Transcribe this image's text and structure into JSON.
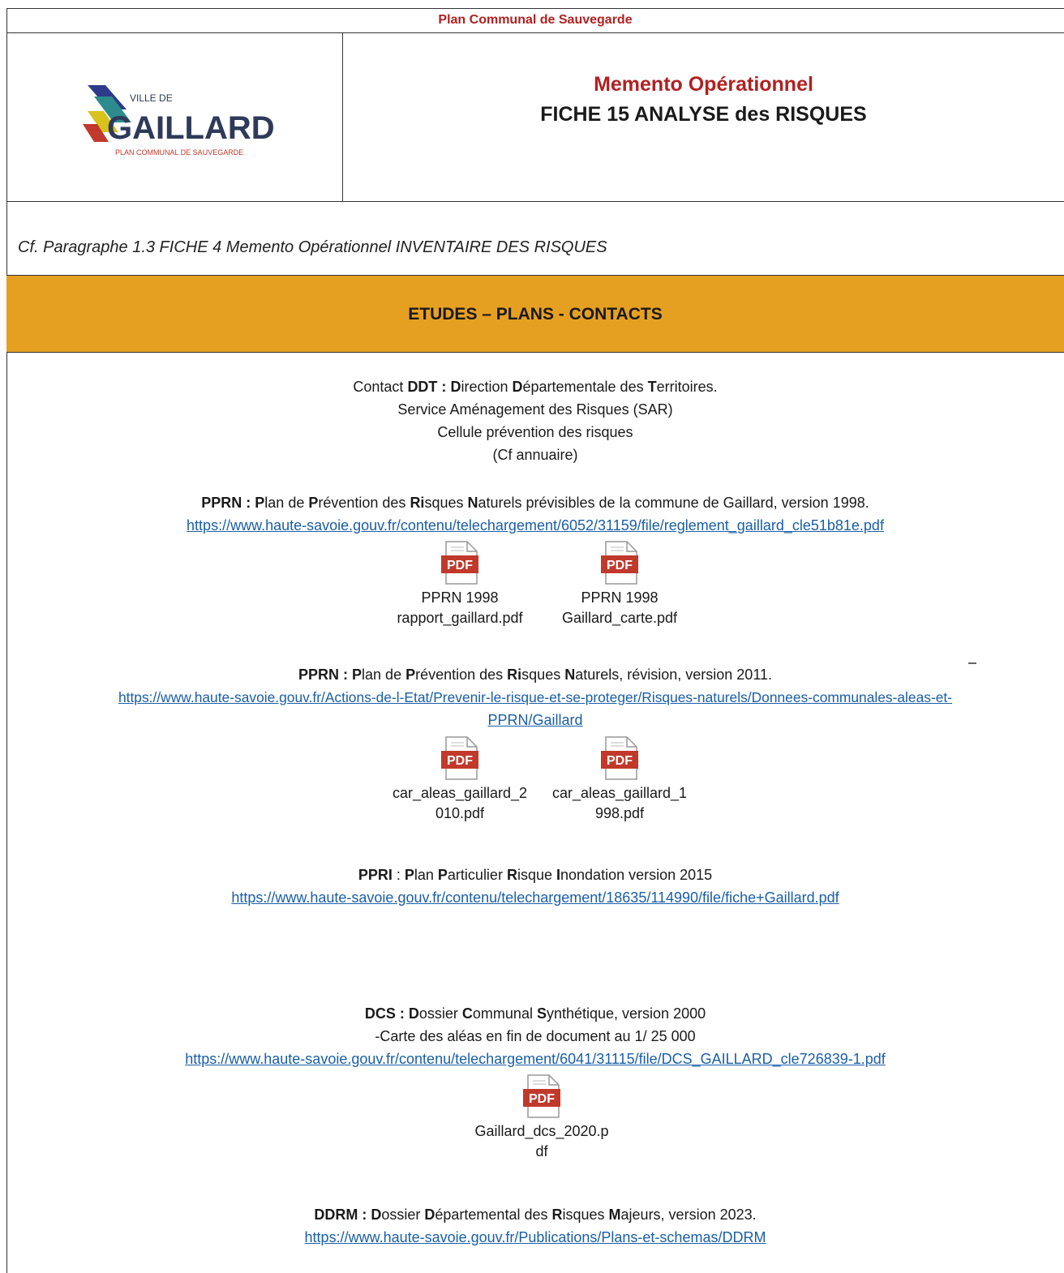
{
  "header": {
    "band_title": "Plan Communal de Sauvegarde",
    "logo": {
      "line1": "VILLE DE",
      "name": "GAILLARD",
      "tagline": "PLAN COMMUNAL DE SAUVEGARDE"
    },
    "title": "Memento Opérationnel",
    "subtitle": "FICHE 15 ANALYSE des RISQUES"
  },
  "reference": "Cf.  Paragraphe 1.3 FICHE 4 Memento Opérationnel INVENTAIRE DES RISQUES",
  "section_title": "ETUDES – PLANS - CONTACTS",
  "contact": {
    "l1_a": "Contact ",
    "l1_b": "DDT :",
    "l1_c": " ",
    "l1_d": "D",
    "l1_e": "irection ",
    "l1_f": "D",
    "l1_g": "épartementale des ",
    "l1_h": "T",
    "l1_i": "erritoires.",
    "line2": "Service Aménagement des Risques (SAR)",
    "line3": "Cellule prévention des risques",
    "line4": "(Cf annuaire)"
  },
  "pprn1998": {
    "t1": "PPRN :",
    "t2": " ",
    "t3": "P",
    "t4": "lan de ",
    "t5": "P",
    "t6": "révention des ",
    "t7": "Ri",
    "t8": "sques ",
    "t9": "N",
    "t10": "aturels prévisibles de la commune de Gaillard, version 1998.",
    "url": "https://www.haute-savoie.gouv.fr/contenu/telechargement/6052/31159/file/reglement_gaillard_cle51b81e.pdf",
    "files": [
      {
        "icon": "pdf-icon",
        "line1": "PPRN  1998",
        "line2": "rapport_gaillard.pdf"
      },
      {
        "icon": "pdf-icon",
        "line1": "PPRN 1998",
        "line2": "Gaillard_carte.pdf"
      }
    ]
  },
  "pprn2011": {
    "t1": "PPRN :",
    "t2": " ",
    "t3": "P",
    "t4": "lan de ",
    "t5": "P",
    "t6": "révention des ",
    "t7": "Ri",
    "t8": "sques ",
    "t9": "N",
    "t10": "aturels, révision, version 2011.",
    "url_line1": "https://www.haute-savoie.gouv.fr/Actions-de-l-Etat/Prevenir-le-risque-et-se-proteger/Risques-naturels/Donnees-communales-aleas-et-",
    "url_line2": "PPRN/Gaillard",
    "files": [
      {
        "icon": "pdf-icon",
        "line1": "car_aleas_gaillard_2",
        "line2": "010.pdf"
      },
      {
        "icon": "pdf-icon",
        "line1": "car_aleas_gaillard_1",
        "line2": "998.pdf"
      }
    ]
  },
  "ppri": {
    "t1": "PPRI",
    "t2": " : ",
    "t3": "P",
    "t4": "lan ",
    "t5": "P",
    "t6": "articulier ",
    "t7": "R",
    "t8": "isque ",
    "t9": "I",
    "t10": "nondation version 2015",
    "url": "https://www.haute-savoie.gouv.fr/contenu/telechargement/18635/114990/file/fiche+Gaillard.pdf"
  },
  "dcs": {
    "t1": "DCS :",
    "t2": " ",
    "t3": "D",
    "t4": "ossier ",
    "t5": "C",
    "t6": "ommunal ",
    "t7": "S",
    "t8": "ynthétique, version 2000",
    "line2": "-Carte des aléas en fin de document au 1/ 25 000",
    "url": "https://www.haute-savoie.gouv.fr/contenu/telechargement/6041/31115/file/DCS_GAILLARD_cle726839-1.pdf",
    "file": {
      "icon": "pdf-icon",
      "line1": "Gaillard_dcs_2020.p",
      "line2": "df"
    }
  },
  "ddrm": {
    "t1": "DDRM :",
    "t2": " ",
    "t3": "D",
    "t4": "ossier ",
    "t5": "D",
    "t6": "épartemental des ",
    "t7": "R",
    "t8": "isques ",
    "t9": "M",
    "t10": "ajeurs, version 2023.",
    "url": "https://www.haute-savoie.gouv.fr/Publications/Plans-et-schemas/DDRM"
  },
  "colors": {
    "accent_red": "#b22020",
    "band_orange": "#e6a021",
    "link_blue": "#1a5fa8"
  }
}
